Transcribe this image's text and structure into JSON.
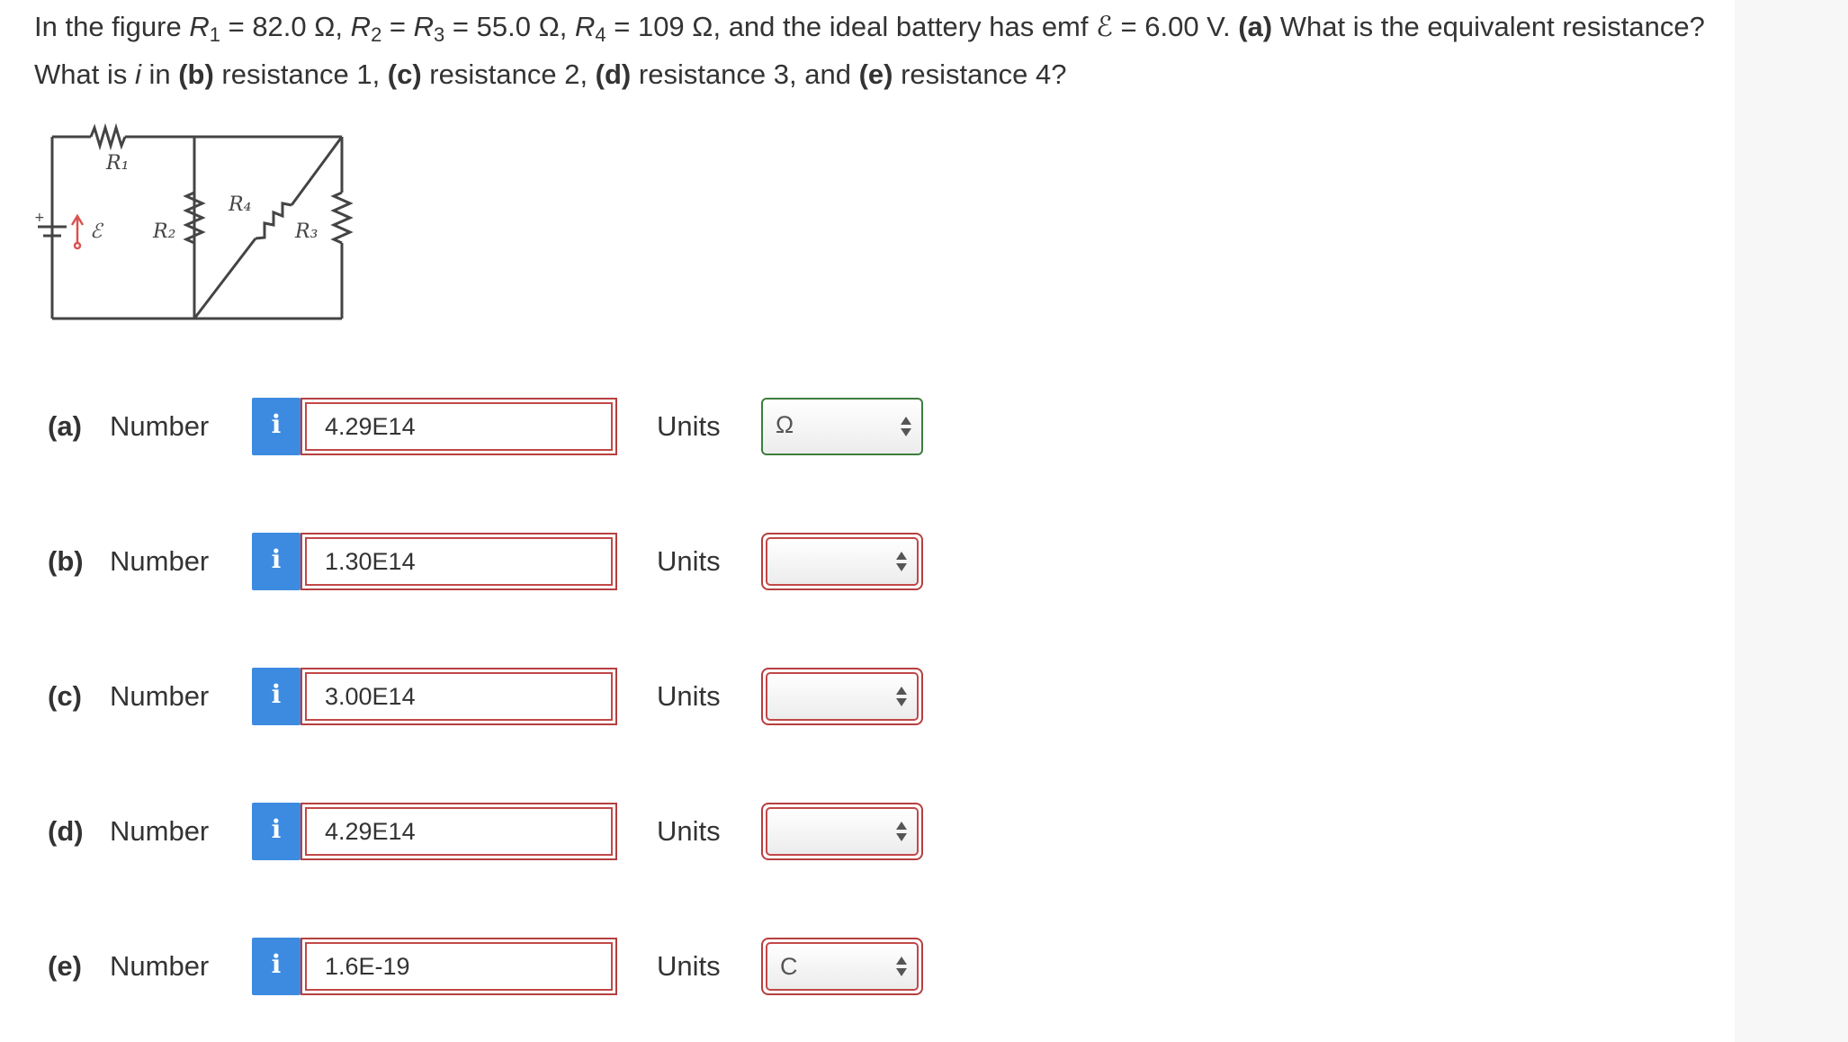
{
  "question": {
    "intro": "In the figure ",
    "r1_label": "R",
    "r1_sub": "1",
    "r1_val": " = 82.0 Ω, ",
    "r2_label": "R",
    "r2_sub": "2",
    "r2_eq": " = ",
    "r3_label": "R",
    "r3_sub": "3",
    "r3_val": " = 55.0 Ω, ",
    "r4_label": "R",
    "r4_sub": "4",
    "r4_val": " = 109 Ω, and the ideal battery has emf ",
    "emf_symbol": "ℰ",
    "emf_val": " = 6.00 V. ",
    "part_a": "(a)",
    "text_a": " What is the equivalent resistance? What is ",
    "i_symbol": "i",
    "text_in": " in ",
    "part_b": "(b)",
    "text_b": " resistance 1, ",
    "part_c": "(c)",
    "text_c": " resistance 2, ",
    "part_d": "(d)",
    "text_d": " resistance 3, and ",
    "part_e": "(e)",
    "text_e": " resistance 4?"
  },
  "figure": {
    "label_r1": "R₁",
    "label_r2": "R₂",
    "label_r3": "R₃",
    "label_r4": "R₄",
    "label_emf": "ℰ",
    "label_plus": "+"
  },
  "info_glyph": "i",
  "answers": [
    {
      "part": "(a)",
      "number_label": "Number",
      "value": "4.29E14",
      "units_label": "Units",
      "unit": "Ω",
      "unit_state": "ok"
    },
    {
      "part": "(b)",
      "number_label": "Number",
      "value": "1.30E14",
      "units_label": "Units",
      "unit": "",
      "unit_state": "error"
    },
    {
      "part": "(c)",
      "number_label": "Number",
      "value": "3.00E14",
      "units_label": "Units",
      "unit": "",
      "unit_state": "error"
    },
    {
      "part": "(d)",
      "number_label": "Number",
      "value": "4.29E14",
      "units_label": "Units",
      "unit": "",
      "unit_state": "error"
    },
    {
      "part": "(e)",
      "number_label": "Number",
      "value": "1.6E-19",
      "units_label": "Units",
      "unit": "C",
      "unit_state": "error"
    }
  ],
  "colors": {
    "info_button": "#3d8be0",
    "error_border": "#b63f3f",
    "ok_border": "#3e7d3e"
  }
}
